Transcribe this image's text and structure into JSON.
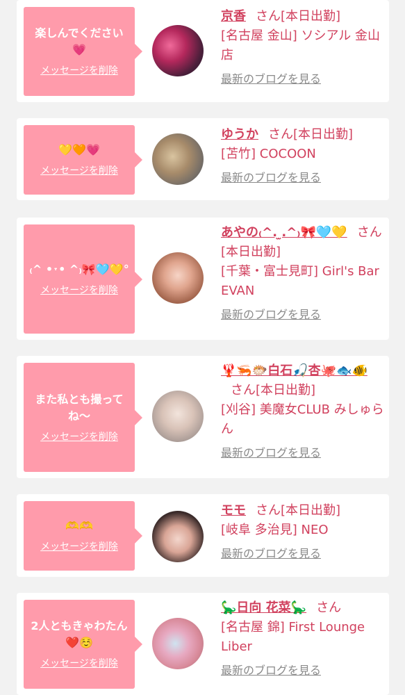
{
  "colors": {
    "accent": "#d1415e",
    "bubble": "#ff9bab",
    "muted": "#8a8a8a",
    "background": "#f2f2f2"
  },
  "delete_label": "メッセージを削除",
  "blog_label": "最新のブログを見る",
  "san_label": "さん",
  "attendance_label": "[本日出勤]",
  "cards": [
    {
      "message": "楽しんでください💗",
      "name": "京香",
      "location": "[名古屋 金山] ソシアル 金山店"
    },
    {
      "message": "💛🧡💗",
      "name": "ゆうか",
      "location": "[苫竹] COCOON"
    },
    {
      "message": "₍^ •˕• ^₎🎀🩵💛°",
      "name": "あやの₍^. ̫.^₎🎀🩵💛",
      "location": "[千葉・富士見町] Girl's Bar EVAN"
    },
    {
      "message": "また私とも撮ってね〜",
      "name": "🦞🦐🐡白石🎣杏🐙🐟🐠",
      "location": "[刈谷] 美魔女CLUB みしゅらん"
    },
    {
      "message": "🫶🫶",
      "name": "モモ",
      "location": "[岐阜 多治見] NEO"
    },
    {
      "message": "2人ともきゃわたん❤️☺️",
      "name": "🦕日向 花菜🦕",
      "location": "[名古屋 錦] First Lounge Liber"
    }
  ]
}
